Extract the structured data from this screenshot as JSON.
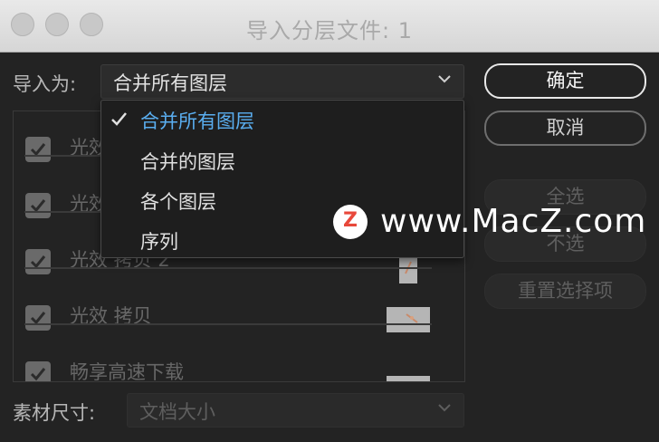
{
  "window": {
    "title": "导入分层文件: 1"
  },
  "import_as": {
    "label": "导入为:",
    "value": "合并所有图层",
    "options": [
      "合并所有图层",
      "合并的图层",
      "各个图层",
      "序列"
    ]
  },
  "buttons": {
    "ok": "确定",
    "cancel": "取消",
    "select_all": "全选",
    "select_none": "不选",
    "reset_selection": "重置选择项"
  },
  "layers": [
    {
      "label": "光效",
      "checked": true
    },
    {
      "label": "光效",
      "checked": true
    },
    {
      "label": "光效 拷贝 2",
      "checked": true
    },
    {
      "label": "光效 拷贝",
      "checked": true
    },
    {
      "label": "畅享高速下载",
      "checked": true
    }
  ],
  "footage_size": {
    "label": "素材尺寸:",
    "value": "文档大小"
  },
  "watermark": {
    "logo_letter": "Z",
    "text": "www.MacZ.com"
  },
  "colors": {
    "accent": "#5aaef0",
    "watermark_logo": "#e8483b"
  }
}
